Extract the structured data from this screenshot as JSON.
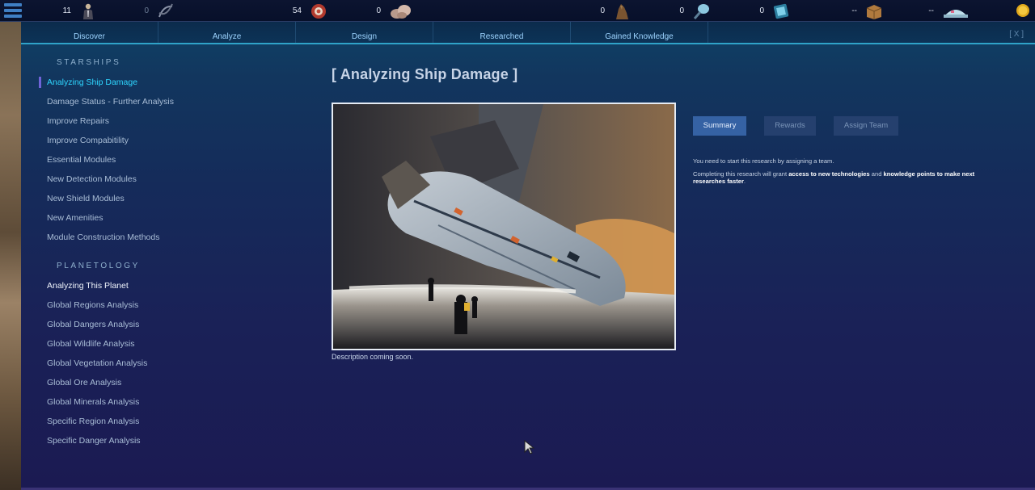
{
  "topbar": {
    "resources": [
      {
        "value": "11",
        "icon": "commander-icon"
      },
      {
        "value": "0",
        "icon": "dna-icon"
      },
      {
        "value": "54",
        "icon": "meat-icon"
      },
      {
        "value": "0",
        "icon": "ore-icon"
      },
      {
        "value": "0",
        "icon": "creature-icon"
      },
      {
        "value": "0",
        "icon": "crystal-icon"
      },
      {
        "value": "0",
        "icon": "datapad-icon"
      },
      {
        "value": "--",
        "icon": "crate-icon"
      },
      {
        "value": "--",
        "icon": "habitat-icon"
      }
    ],
    "credits_icon": "coin-icon"
  },
  "tabs": [
    "Discover",
    "Analyze",
    "Design",
    "Researched",
    "Gained Knowledge"
  ],
  "close_label": "[ X ]",
  "sidebar": {
    "starships_title": "STARSHIPS",
    "starships": [
      "Analyzing Ship Damage",
      "Damage Status - Further Analysis",
      "Improve Repairs",
      "Improve Compabitility",
      "Essential Modules",
      "New Detection Modules",
      "New Shield Modules",
      "New Amenities",
      "Module Construction Methods"
    ],
    "planetology_title": "PLANETOLOGY",
    "planetology": [
      "Analyzing This Planet",
      "Global Regions Analysis",
      "Global Dangers Analysis",
      "Global Wildlife Analysis",
      "Global Vegetation Analysis",
      "Global Ore Analysis",
      "Global Minerals Analysis",
      "Specific Region Analysis",
      "Specific Danger Analysis"
    ]
  },
  "main": {
    "title": "[ Analyzing Ship Damage ]",
    "description": "Description coming soon.",
    "buttons": {
      "summary": "Summary",
      "rewards": "Rewards",
      "assign": "Assign Team"
    },
    "info_line1": "You need to start this research by assigning a team.",
    "info_line2_prefix": "Completing this research will grant ",
    "info_line2_bold1": "access to new technologies",
    "info_line2_mid": " and ",
    "info_line2_bold2": "knowledge points to make next researches faster",
    "info_line2_suffix": "."
  },
  "colors": {
    "accent_cyan": "#2ed6ff",
    "tab_text": "#9dd4ff",
    "primary_button": "#3562a4"
  }
}
